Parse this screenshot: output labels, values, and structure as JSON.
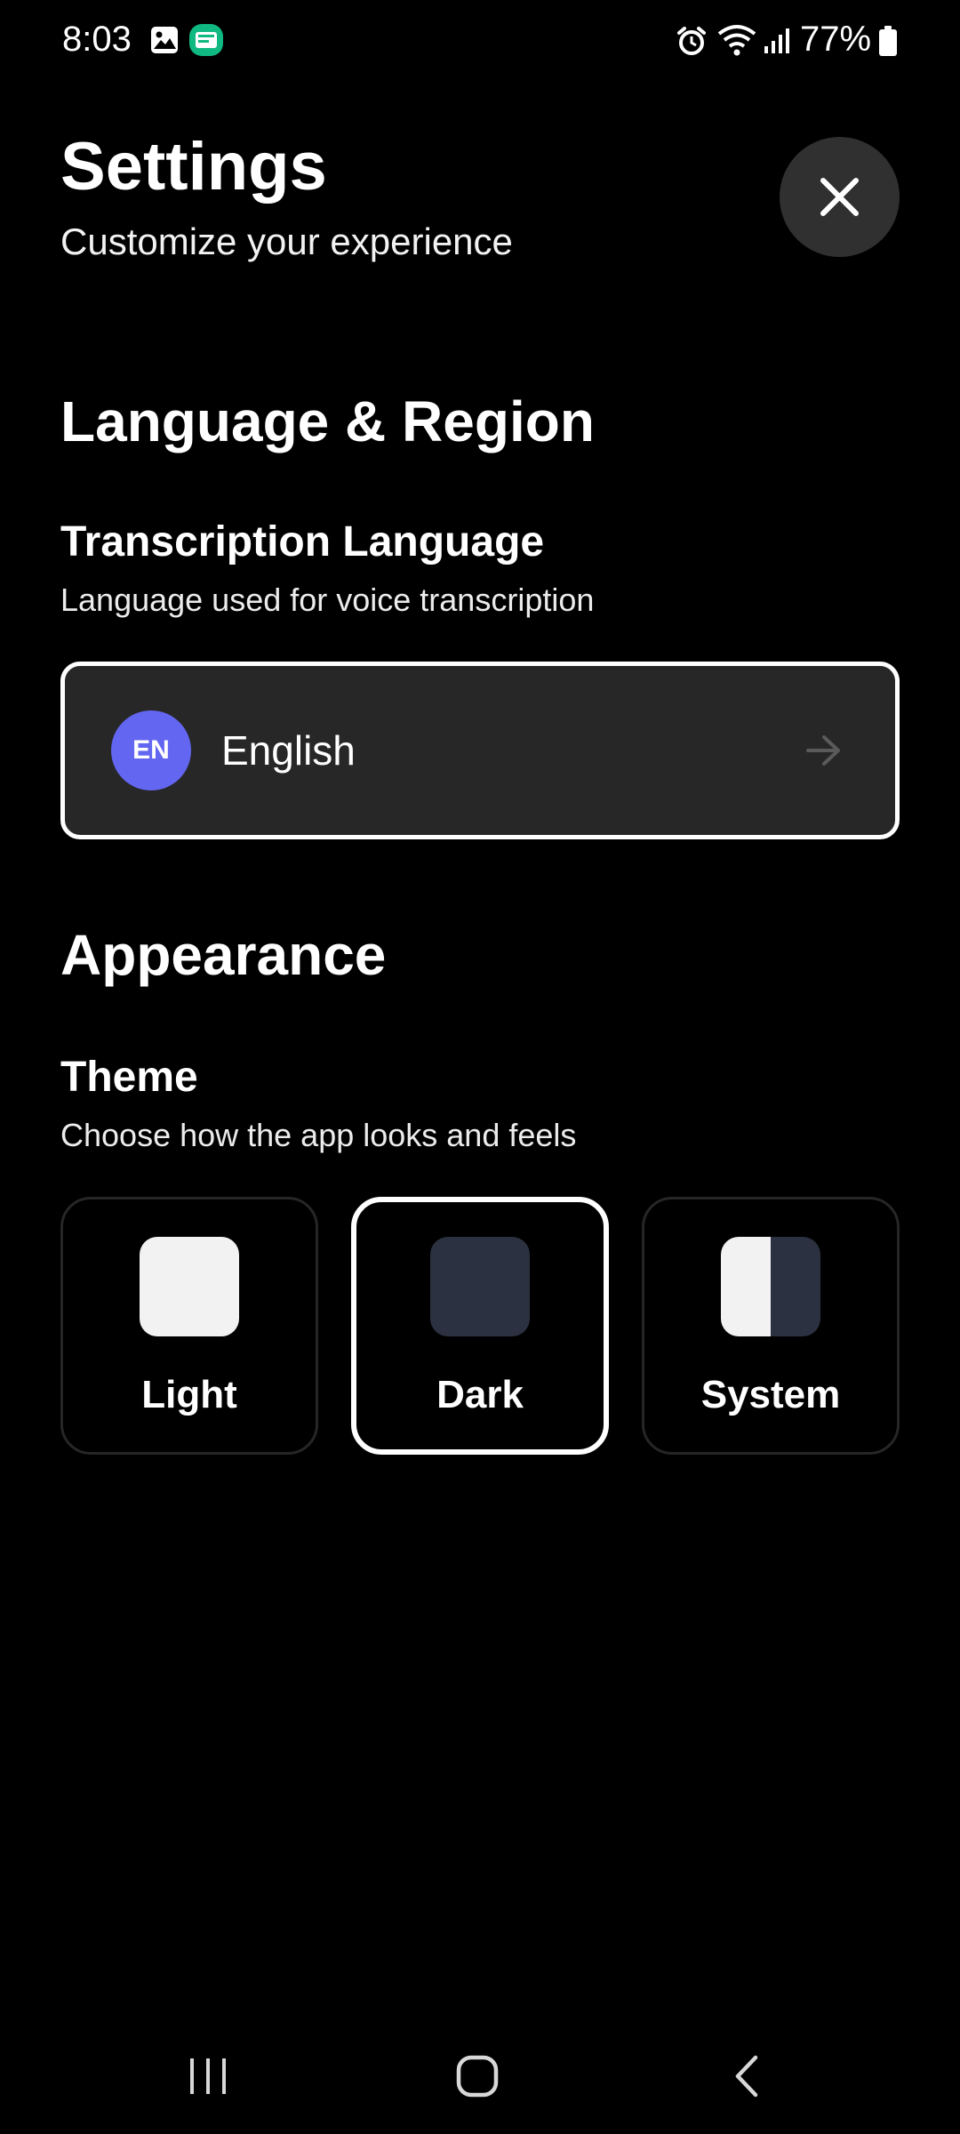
{
  "status_bar": {
    "time": "8:03",
    "battery": "77%",
    "icons": [
      "gallery-icon",
      "app-notification-icon",
      "alarm-icon",
      "wifi-icon",
      "signal-icon",
      "battery-icon"
    ]
  },
  "header": {
    "title": "Settings",
    "subtitle": "Customize your experience",
    "close_icon": "close-icon"
  },
  "language_region": {
    "section_title": "Language & Region",
    "transcription": {
      "label": "Transcription Language",
      "description": "Language used for voice transcription",
      "badge": "EN",
      "value": "English",
      "badge_color": "#6366f1",
      "arrow_icon": "arrow-right-icon"
    }
  },
  "appearance": {
    "section_title": "Appearance",
    "theme": {
      "label": "Theme",
      "description": "Choose how the app looks and feels",
      "options": [
        {
          "label": "Light",
          "selected": false,
          "swatch_color": "#f2f2f2"
        },
        {
          "label": "Dark",
          "selected": true,
          "swatch_color": "#2b3140"
        },
        {
          "label": "System",
          "selected": false,
          "swatch_color": "#f2f2f2 / #2b3140"
        }
      ]
    }
  },
  "nav_bar": {
    "icons": [
      "recent-apps-icon",
      "home-icon",
      "back-icon"
    ]
  },
  "colors": {
    "background": "#000000",
    "card": "#272727",
    "close_button": "#303030",
    "accent": "#6366f1"
  }
}
